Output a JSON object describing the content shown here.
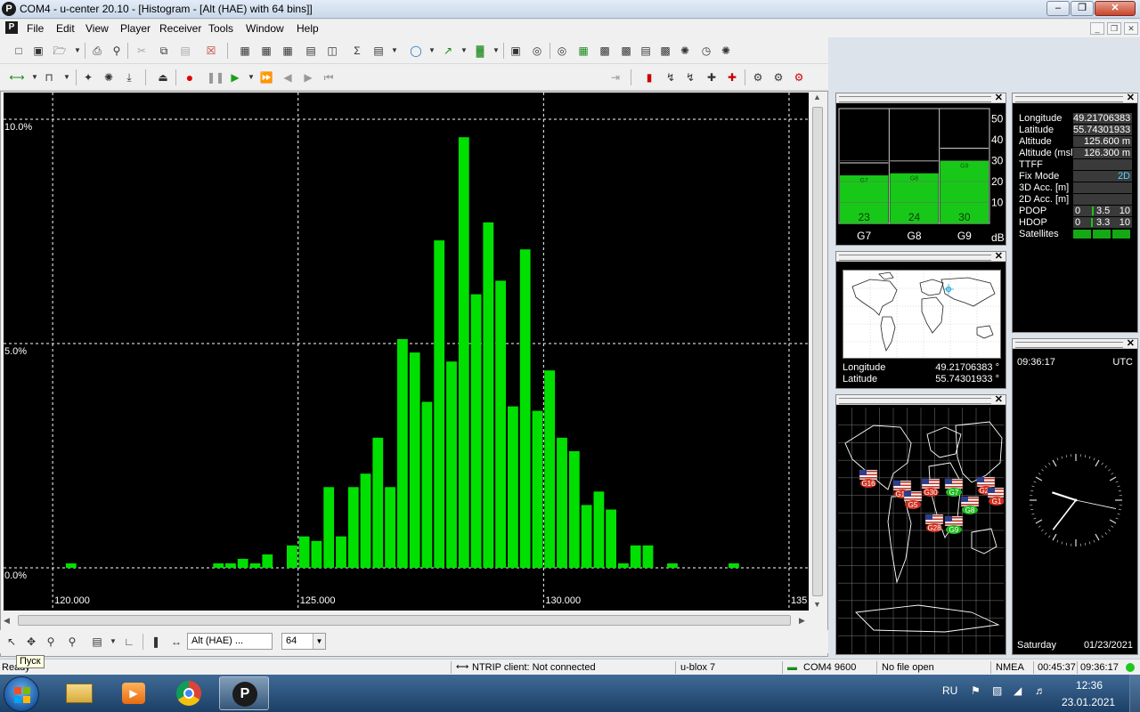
{
  "window": {
    "title": "COM4 - u-center 20.10 - [Histogram - [Alt (HAE) with 64 bins]]"
  },
  "menu": {
    "items": [
      "File",
      "Edit",
      "View",
      "Player",
      "Receiver",
      "Tools",
      "Window",
      "Help"
    ]
  },
  "histogram": {
    "field": "Alt (HAE) ...",
    "bins": "64",
    "chart_data": {
      "type": "bar",
      "title": "Histogram - [Alt (HAE) with 64 bins]",
      "x_ticks": [
        "120.000",
        "125.000",
        "130.000",
        "135"
      ],
      "y_ticks": [
        "10.0%",
        "5.0%",
        "0.0%"
      ],
      "xlim": [
        119,
        135.4
      ],
      "ylim": [
        0,
        10
      ],
      "bin_width": 0.25,
      "bars": [
        {
          "x": 120.375,
          "y": 0.1
        },
        {
          "x": 123.375,
          "y": 0.1
        },
        {
          "x": 123.625,
          "y": 0.1
        },
        {
          "x": 123.875,
          "y": 0.2
        },
        {
          "x": 124.125,
          "y": 0.1
        },
        {
          "x": 124.375,
          "y": 0.3
        },
        {
          "x": 124.875,
          "y": 0.5
        },
        {
          "x": 125.125,
          "y": 0.7
        },
        {
          "x": 125.375,
          "y": 0.6
        },
        {
          "x": 125.625,
          "y": 1.8
        },
        {
          "x": 125.875,
          "y": 0.7
        },
        {
          "x": 126.125,
          "y": 1.8
        },
        {
          "x": 126.375,
          "y": 2.1
        },
        {
          "x": 126.625,
          "y": 2.9
        },
        {
          "x": 126.875,
          "y": 1.8
        },
        {
          "x": 127.125,
          "y": 5.1
        },
        {
          "x": 127.375,
          "y": 4.8
        },
        {
          "x": 127.625,
          "y": 3.7
        },
        {
          "x": 127.875,
          "y": 7.3
        },
        {
          "x": 128.125,
          "y": 4.6
        },
        {
          "x": 128.375,
          "y": 9.6
        },
        {
          "x": 128.625,
          "y": 6.1
        },
        {
          "x": 128.875,
          "y": 7.7
        },
        {
          "x": 129.125,
          "y": 6.4
        },
        {
          "x": 129.375,
          "y": 3.6
        },
        {
          "x": 129.625,
          "y": 7.1
        },
        {
          "x": 129.875,
          "y": 3.5
        },
        {
          "x": 130.125,
          "y": 4.4
        },
        {
          "x": 130.375,
          "y": 2.9
        },
        {
          "x": 130.625,
          "y": 2.6
        },
        {
          "x": 130.875,
          "y": 1.4
        },
        {
          "x": 131.125,
          "y": 1.7
        },
        {
          "x": 131.375,
          "y": 1.3
        },
        {
          "x": 131.625,
          "y": 0.1
        },
        {
          "x": 131.875,
          "y": 0.5
        },
        {
          "x": 132.125,
          "y": 0.5
        },
        {
          "x": 132.625,
          "y": 0.1
        },
        {
          "x": 133.875,
          "y": 0.1
        }
      ],
      "grid": true,
      "colors": {
        "bars": "#00e000",
        "background": "#000000",
        "grid": "#ffffff"
      }
    }
  },
  "satellites": {
    "chart_data": {
      "type": "bar",
      "categories": [
        "G7",
        "G8",
        "G9"
      ],
      "values": [
        23,
        24,
        30
      ],
      "y_ticks": [
        "50",
        "40",
        "30",
        "20",
        "10"
      ],
      "unit": "dB",
      "ylim": [
        0,
        55
      ]
    }
  },
  "world_map": {
    "longitude_label": "Longitude",
    "longitude_value": "49.21706383 °",
    "latitude_label": "Latitude",
    "latitude_value": "55.74301933 °"
  },
  "sky_map": {
    "satellites": [
      "G16",
      "G13",
      "G5",
      "G30",
      "G7",
      "G27",
      "G8",
      "G28",
      "G9",
      "G1"
    ]
  },
  "nav": {
    "rows": [
      {
        "label": "Longitude",
        "value": "49.21706383 °"
      },
      {
        "label": "Latitude",
        "value": "55.74301933 °"
      },
      {
        "label": "Altitude",
        "value": "125.600 m"
      },
      {
        "label": "Altitude (msl)",
        "value": "126.300 m"
      },
      {
        "label": "TTFF",
        "value": ""
      },
      {
        "label": "Fix Mode",
        "value": "2D"
      },
      {
        "label": "3D Acc. [m]",
        "value": ""
      },
      {
        "label": "2D Acc. [m]",
        "value": ""
      }
    ],
    "pdop": {
      "label": "PDOP",
      "min": "0",
      "value": "3.5",
      "max": "10",
      "level": 0.35
    },
    "hdop": {
      "label": "HDOP",
      "min": "0",
      "value": "3.3",
      "max": "10",
      "level": 0.33
    },
    "satellites_label": "Satellites"
  },
  "clock": {
    "time": "09:36:17",
    "zone": "UTC",
    "day": "Saturday",
    "date": "01/23/2021",
    "hour": 9,
    "minute": 36,
    "second": 17
  },
  "tooltip": "Пуск",
  "status": {
    "ready": "Ready",
    "ntrip": "NTRIP client: Not connected",
    "receiver": "u-blox 7",
    "port": "COM4 9600",
    "file": "No file open",
    "protocol": "NMEA",
    "elapsed": "00:45:37",
    "clock": "09:36:17"
  },
  "taskbar": {
    "lang": "RU",
    "time": "12:36",
    "date": "23.01.2021"
  }
}
